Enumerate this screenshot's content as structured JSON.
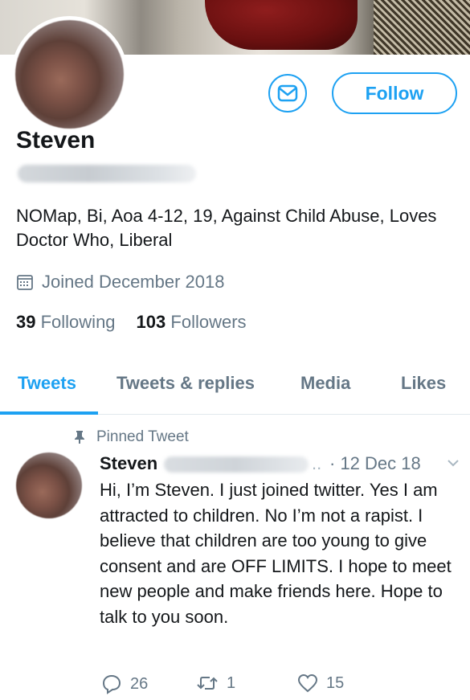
{
  "colors": {
    "accent": "#1da1f2",
    "text": "#14171a",
    "muted": "#657786",
    "divider": "#e1e8ed"
  },
  "profile": {
    "name": "Steven",
    "bio": "NOMap, Bi, Aoa 4-12, 19, Against Child Abuse, Loves Doctor Who, Liberal",
    "joined": "Joined December 2018",
    "following_count": "39",
    "following_label": "Following",
    "followers_count": "103",
    "followers_label": "Followers"
  },
  "buttons": {
    "follow": "Follow",
    "message_icon": "envelope-icon"
  },
  "tabs": [
    {
      "label": "Tweets",
      "active": true
    },
    {
      "label": "Tweets & replies"
    },
    {
      "label": "Media"
    },
    {
      "label": "Likes"
    }
  ],
  "tweet": {
    "pinned_label": "Pinned Tweet",
    "author": "Steven",
    "ellipsis": "..",
    "time": "· 12 Dec 18",
    "text": "Hi, I’m Steven. I just joined twitter. Yes I am attracted to children. No I’m not a rapist. I believe that children are too young to give consent and are OFF LIMITS. I hope to meet new people and make friends here. Hope to talk to you soon.",
    "replies": "26",
    "retweets": "1",
    "likes": "15"
  },
  "icons": [
    "pin-icon",
    "calendar-icon",
    "chevron-down-icon",
    "reply-icon",
    "retweet-icon",
    "heart-icon"
  ]
}
